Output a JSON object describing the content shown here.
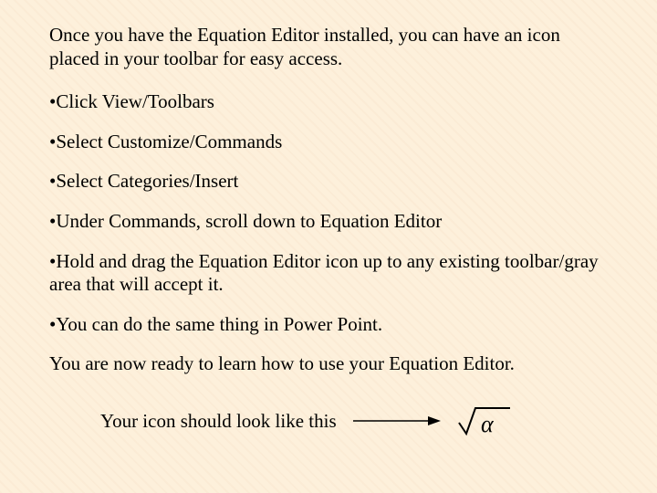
{
  "intro": "Once you have the Equation Editor installed, you can have an icon placed in your toolbar for easy access.",
  "bullet": "•",
  "steps": [
    "Click View/Toolbars",
    "Select Customize/Commands",
    "Select Categories/Insert",
    "Under Commands, scroll down to Equation Editor",
    "Hold and drag the Equation Editor icon up to any existing toolbar/gray area that will accept it.",
    "You can do the same thing in Power Point."
  ],
  "closing": "You are now ready to learn how to use your Equation Editor.",
  "iconline": "Your icon should look like this",
  "icon_name": "equation-editor-icon",
  "icon_glyph": "α"
}
